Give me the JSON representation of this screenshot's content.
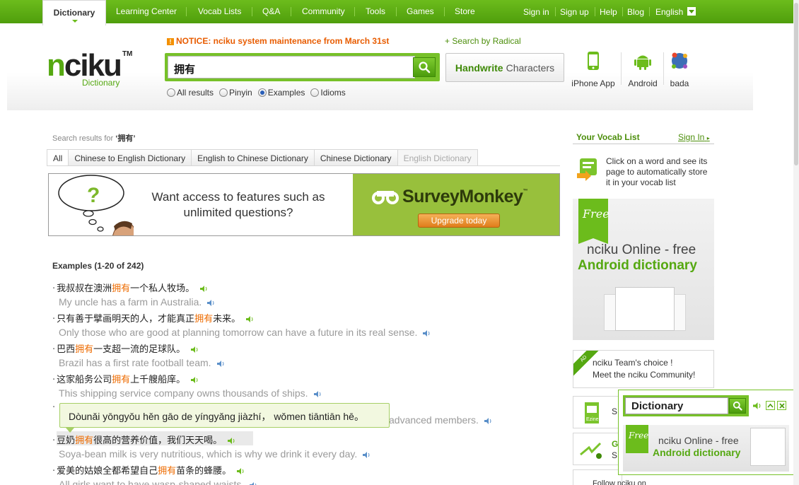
{
  "nav": {
    "active_tab": "Dictionary",
    "links": [
      "Learning Center",
      "Vocab Lists",
      "Q&A",
      "Community",
      "Tools",
      "Games",
      "Store"
    ],
    "right": [
      "Sign in",
      "Sign up",
      "Help",
      "Blog"
    ],
    "language": "English"
  },
  "header": {
    "logo_a": "n",
    "logo_b": "ciku",
    "logo_tm": "TM",
    "logo_sub": "Dictionary",
    "notice": "NOTICE: nciku system maintenance from March 31st",
    "radical": "+ Search by Radical",
    "search_value": "拥有",
    "handwrite_bold": "Handwrite",
    "handwrite_rest": "Characters",
    "radios": [
      "All results",
      "Pinyin",
      "Examples",
      "Idioms"
    ],
    "selected_radio": "Examples",
    "apps": [
      "iPhone App",
      "Android",
      "bada"
    ]
  },
  "results": {
    "label": "Search results for",
    "query": "‘拥有’",
    "tabs": [
      "All",
      "Chinese to English Dictionary",
      "English to Chinese Dictionary",
      "Chinese Dictionary",
      "English Dictionary"
    ],
    "active_tab": "All"
  },
  "ad": {
    "text_line1": "Want access to features such as",
    "text_line2": "unlimited questions?",
    "brand": "SurveyMonkey",
    "button": "Upgrade today"
  },
  "examples": {
    "heading": "Examples (1-20 of 242)",
    "items": [
      {
        "pre": "我叔叔在澳洲",
        "hl": "拥有",
        "post": "一个私人牧场。",
        "en": "My uncle has a farm in Australia."
      },
      {
        "pre": "只有善于擘画明天的人，才能真正",
        "hl": "拥有",
        "post": "未来。",
        "en": "Only those who are good at planning tomorrow can have a future in its real sense."
      },
      {
        "pre": "巴西",
        "hl": "拥有",
        "post": "一支超一流的足球队。",
        "en": "Brazil has a first rate football team."
      },
      {
        "pre": "这家船务公司",
        "hl": "拥有",
        "post": "上千艘船庠。",
        "en": "This shipping service company owns thousands of ships."
      },
      {
        "pre": "",
        "hl": "",
        "post": "",
        "en": "advanced members."
      },
      {
        "pre": "豆奶",
        "hl": "拥有",
        "post": "很高的营养价值，我们天天喝。",
        "en": "Soya-bean milk is very nutritious, which is why we drink it every day."
      },
      {
        "pre": "爱美的姑娘全都希望自己",
        "hl": "拥有",
        "post": "苗条的蜂腰。",
        "en": "All girls want to have wasp-shaped waists."
      }
    ],
    "tooltip": "Dòunǎi yōngyǒu hěn gāo de yíngyǎng jiàzhí， wǒmen tiāntiān hē。"
  },
  "sidebar": {
    "vocab_title": "Your Vocab List",
    "sign_in": "Sign In",
    "vocab_text": "Click on a word and see its page to automatically store it in your vocab list",
    "promo_flag": "Free",
    "promo_line1": "nciku Online - free",
    "promo_line2": "Android dictionary",
    "team_badge": "AD",
    "team_line1": "nciku Team's choice !",
    "team_line2": "Meet the nciku Community!",
    "partial_label_1": "S",
    "partial_label_2": "G",
    "partial_label_3": "S",
    "follow": "Follow nciku on"
  },
  "widget": {
    "search_value": "Dictionary",
    "promo_flag": "Free",
    "promo_line1": "nciku Online - free",
    "promo_line2": "Android dictionary"
  },
  "colors": {
    "brand_green": "#55a811",
    "nav_green": "#5fae15",
    "highlight_orange": "#ee6b00"
  }
}
